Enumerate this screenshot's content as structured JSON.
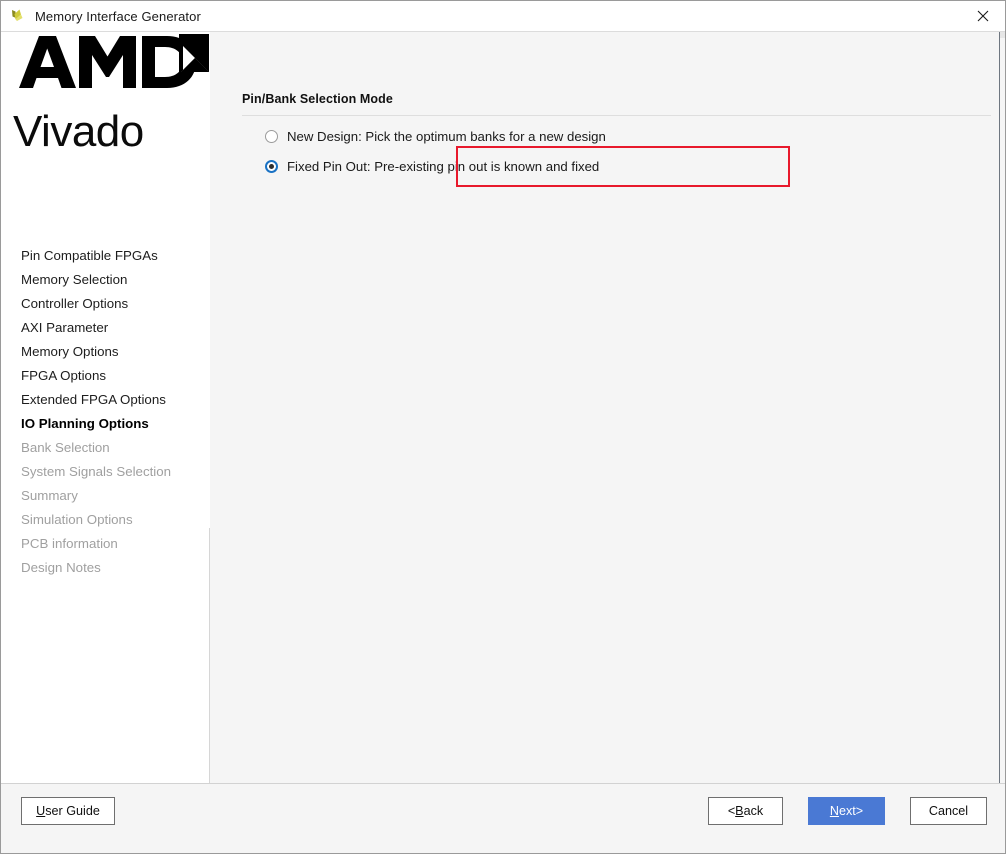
{
  "window": {
    "title": "Memory Interface Generator",
    "app_icon": "vivado-leaf-icon",
    "close_icon": "close-icon"
  },
  "sidebar": {
    "brand": {
      "logo": "amd-logo",
      "wordmark": "Vivado"
    },
    "items": [
      {
        "label": "Pin Compatible FPGAs",
        "state": "available"
      },
      {
        "label": "Memory Selection",
        "state": "available"
      },
      {
        "label": "Controller Options",
        "state": "available"
      },
      {
        "label": "AXI Parameter",
        "state": "available"
      },
      {
        "label": "Memory Options",
        "state": "available"
      },
      {
        "label": "FPGA Options",
        "state": "available"
      },
      {
        "label": "Extended FPGA Options",
        "state": "available"
      },
      {
        "label": "IO Planning Options",
        "state": "active"
      },
      {
        "label": "Bank Selection",
        "state": "disabled"
      },
      {
        "label": "System Signals Selection",
        "state": "disabled"
      },
      {
        "label": "Summary",
        "state": "disabled"
      },
      {
        "label": "Simulation Options",
        "state": "disabled"
      },
      {
        "label": "PCB information",
        "state": "disabled"
      },
      {
        "label": "Design Notes",
        "state": "disabled"
      }
    ]
  },
  "main": {
    "section_title": "Pin/Bank Selection Mode",
    "options": [
      {
        "label": "New Design: Pick the optimum banks for a new design",
        "selected": false,
        "highlighted": false
      },
      {
        "label": "Fixed Pin Out: Pre-existing pin out is known and fixed",
        "selected": true,
        "highlighted": true
      }
    ],
    "highlight_color": "#e8192c"
  },
  "footer": {
    "user_guide": {
      "mnemonic": "U",
      "rest": "ser Guide"
    },
    "back": {
      "prefix": "< ",
      "mnemonic": "B",
      "rest": "ack"
    },
    "next": {
      "mnemonic": "N",
      "rest": "ext",
      "suffix": " >"
    },
    "cancel": "Cancel",
    "next_color": "#4a79d4"
  }
}
